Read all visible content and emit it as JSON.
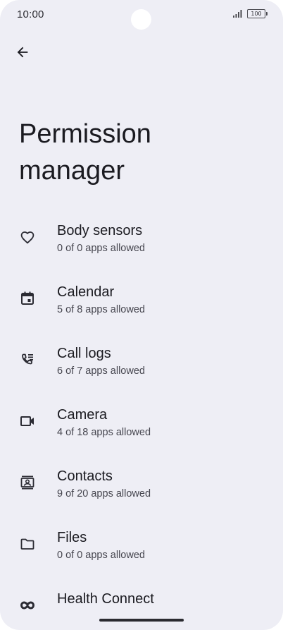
{
  "status_bar": {
    "time": "10:00",
    "battery_level": "100"
  },
  "header": {
    "back_icon": "arrow-back-icon",
    "title": "Permission manager"
  },
  "permissions": [
    {
      "label": "Body sensors",
      "summary": "0 of 0 apps allowed",
      "icon": "heart-icon"
    },
    {
      "label": "Calendar",
      "summary": "5 of 8 apps allowed",
      "icon": "calendar-icon"
    },
    {
      "label": "Call logs",
      "summary": "6 of 7 apps allowed",
      "icon": "call-log-icon"
    },
    {
      "label": "Camera",
      "summary": "4 of 18 apps allowed",
      "icon": "camera-icon"
    },
    {
      "label": "Contacts",
      "summary": "9 of 20 apps allowed",
      "icon": "contacts-icon"
    },
    {
      "label": "Files",
      "summary": "0 of 0 apps allowed",
      "icon": "folder-icon"
    },
    {
      "label": "Health Connect",
      "summary": "",
      "icon": "health-connect-icon"
    }
  ],
  "colors": {
    "background": "#eeeef5",
    "text_primary": "#1b1b21",
    "text_secondary": "#46464f"
  }
}
